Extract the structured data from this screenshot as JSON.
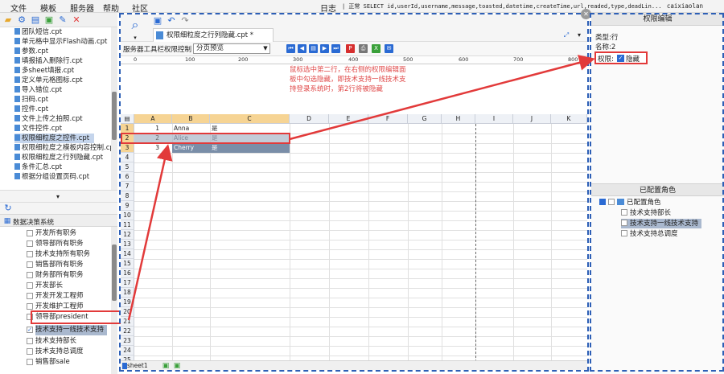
{
  "menubar": {
    "items": [
      "文件",
      "模板",
      "服务器",
      "帮助",
      "社区"
    ],
    "log_label": "日志",
    "log_text": "| 正常 SELECT id,userId,username,message,toasted,datetime,createTime,url,readed,type,deadLin...",
    "user": "caixiaolan"
  },
  "file_tree": {
    "items": [
      {
        "label": "团队短信.cpt"
      },
      {
        "label": "单元格中显示Flash动画.cpt"
      },
      {
        "label": "参数.cpt"
      },
      {
        "label": "填报插入删除行.cpt"
      },
      {
        "label": "多sheet填报.cpt"
      },
      {
        "label": "定义单元格图标.cpt"
      },
      {
        "label": "导入错位.cpt"
      },
      {
        "label": "扫码.cpt"
      },
      {
        "label": "控件.cpt"
      },
      {
        "label": "文件上传之拍照.cpt"
      },
      {
        "label": "文件控件.cpt"
      },
      {
        "label": "权限细粒度之控件.cpt",
        "selected": true
      },
      {
        "label": "权限细粒度之模板内容控制.cpt"
      },
      {
        "label": "权限细粒度之行列隐藏.cpt"
      },
      {
        "label": "条件汇总.cpt"
      },
      {
        "label": "根据分组设置页码.cpt"
      }
    ]
  },
  "decision": {
    "header": "数据决策系统",
    "roles": [
      {
        "label": "开发所有职务"
      },
      {
        "label": "领导部所有职务"
      },
      {
        "label": "技术支持所有职务"
      },
      {
        "label": "销售部所有职务"
      },
      {
        "label": "财务部所有职务"
      },
      {
        "label": "开发部长"
      },
      {
        "label": "开发开发工程师"
      },
      {
        "label": "开发维护工程师"
      },
      {
        "label": "领导部president"
      },
      {
        "label": "技术支持一线技术支持",
        "selected": true,
        "checked": true
      },
      {
        "label": "技术支持部长"
      },
      {
        "label": "技术支持总调度"
      },
      {
        "label": "销售部sale"
      }
    ]
  },
  "designer": {
    "doc_tab": "权限细粒度之行列隐藏.cpt *",
    "toolbar_label": "服务器工具栏权限控制",
    "pager_value": "分页预览",
    "ruler": [
      "0",
      "100",
      "200",
      "300",
      "400",
      "500",
      "600",
      "700",
      "800"
    ],
    "note": "鼠标选中第二行，在右侧的权限编辑面板中勾选隐藏，即技术支持一线技术支持登录系统时，第2行将被隐藏",
    "columns": [
      "A",
      "B",
      "C",
      "D",
      "E",
      "F",
      "G",
      "H",
      "I",
      "J",
      "K"
    ],
    "rows": [
      "1",
      "2",
      "3",
      "4",
      "5",
      "6",
      "7",
      "8",
      "9",
      "10",
      "11",
      "12",
      "13",
      "14",
      "15",
      "16",
      "17",
      "18",
      "19",
      "20",
      "21",
      "22",
      "23",
      "24",
      "25"
    ],
    "cells": [
      [
        "1",
        "Anna",
        "是"
      ],
      [
        "2",
        "Alice",
        "是"
      ],
      [
        "3",
        "Cherry",
        "是"
      ]
    ],
    "sheet_tab": "sheet1"
  },
  "permission": {
    "header": "权限编辑",
    "type_line": "类型:行",
    "name_line": "名称:2",
    "perm_label": "权限:",
    "hide_label": "隐藏",
    "hide_checked": true
  },
  "configured_roles": {
    "header": "已配置角色",
    "root": "已配置角色",
    "items": [
      {
        "label": "技术支持部长"
      },
      {
        "label": "技术支持一线技术支持",
        "selected": true
      },
      {
        "label": "技术支持总调度"
      }
    ]
  },
  "colors": {
    "accent_blue": "#2d5fb6",
    "highlight_red": "#e23a3a",
    "selection": "#a9b8ce",
    "note_red": "#e04b4b"
  }
}
